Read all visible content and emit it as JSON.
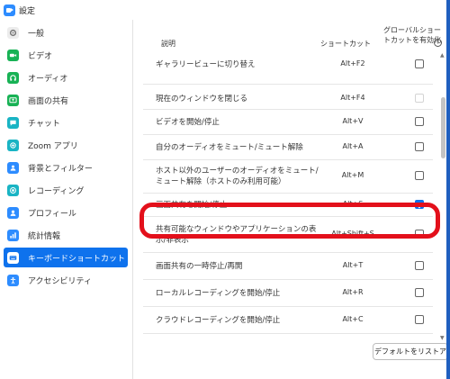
{
  "window": {
    "title": "設定"
  },
  "sidebar": {
    "items": [
      {
        "label": "一般",
        "icon": "gear-icon",
        "color": "#e7e7e7"
      },
      {
        "label": "ビデオ",
        "icon": "video-icon",
        "color": "#e6f6e8"
      },
      {
        "label": "オーディオ",
        "icon": "headphones-icon",
        "color": "#e6f6e8"
      },
      {
        "label": "画面の共有",
        "icon": "screen-share-icon",
        "color": "#e6f6e8"
      },
      {
        "label": "チャット",
        "icon": "chat-icon",
        "color": "#e1f3f7"
      },
      {
        "label": "Zoom アプリ",
        "icon": "apps-icon",
        "color": "#e1f3f7"
      },
      {
        "label": "背景とフィルター",
        "icon": "person-background-icon",
        "color": "#e4effa"
      },
      {
        "label": "レコーディング",
        "icon": "record-icon",
        "color": "#e1f3f7"
      },
      {
        "label": "プロフィール",
        "icon": "profile-icon",
        "color": "#e4effa"
      },
      {
        "label": "統計情報",
        "icon": "statistics-icon",
        "color": "#e4effa"
      },
      {
        "label": "キーボードショートカット",
        "icon": "keyboard-icon",
        "color": "#ffffff",
        "active": true
      },
      {
        "label": "アクセシビリティ",
        "icon": "accessibility-icon",
        "color": "#e4effa"
      }
    ]
  },
  "table": {
    "header": {
      "description": "説明",
      "shortcut": "ショートカット",
      "global": "グローバルショートカットを有効化",
      "help": "?"
    },
    "rows": [
      {
        "description": "ギャラリービューに切り替え",
        "shortcut": "Alt+F2",
        "checked": false,
        "disabled": false
      },
      {
        "description": "現在のウィンドウを閉じる",
        "shortcut": "Alt+F4",
        "checked": false,
        "disabled": true
      },
      {
        "description": "ビデオを開始/停止",
        "shortcut": "Alt+V",
        "checked": false,
        "disabled": false
      },
      {
        "description": "自分のオーディオをミュート/ミュート解除",
        "shortcut": "Alt+A",
        "checked": false,
        "disabled": false
      },
      {
        "description": "ホスト以外のユーザーのオーディオをミュート/ミュート解除（ホストのみ利用可能）",
        "shortcut": "Alt+M",
        "checked": false,
        "disabled": false
      },
      {
        "description": "画面共有を開始/停止",
        "shortcut": "Alt+S",
        "checked": true,
        "disabled": false
      },
      {
        "description": "共有可能なウィンドウやアプリケーションの表示/非表示",
        "shortcut": "Alt+Shift+S",
        "checked": false,
        "disabled": false
      },
      {
        "description": "画面共有の一時停止/再開",
        "shortcut": "Alt+T",
        "checked": false,
        "disabled": false
      },
      {
        "description": "ローカルレコーディングを開始/停止",
        "shortcut": "Alt+R",
        "checked": false,
        "disabled": false
      },
      {
        "description": "クラウドレコーディングを開始/停止",
        "shortcut": "Alt+C",
        "checked": false,
        "disabled": false
      }
    ]
  },
  "footer": {
    "reset_label": "デフォルトをリストア"
  },
  "colors": {
    "accent": "#0e72ed",
    "highlight": "#e3101b"
  }
}
